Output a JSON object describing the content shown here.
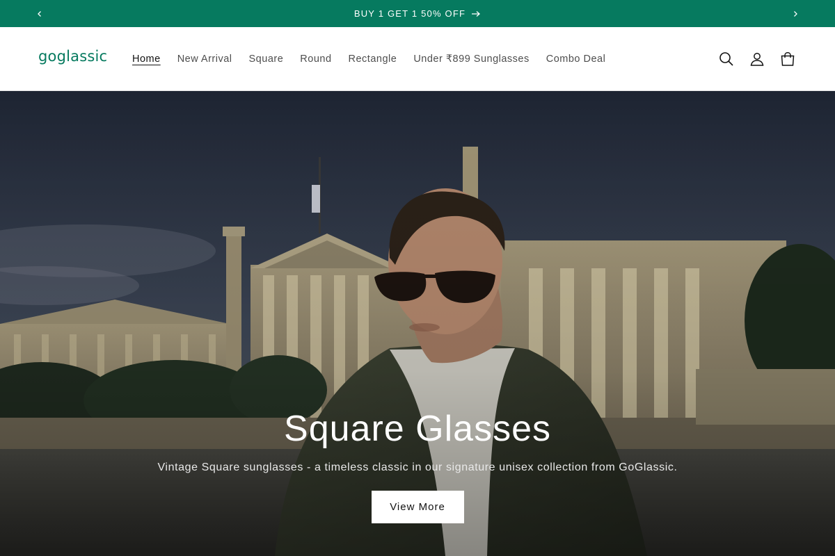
{
  "announcement": {
    "text": "BUY 1 GET 1 50% OFF",
    "prev_icon": "chevron-left-icon",
    "next_icon": "chevron-right-icon",
    "arrow_icon": "arrow-right-icon"
  },
  "header": {
    "logo": "goglassic",
    "nav": [
      {
        "label": "Home",
        "active": true
      },
      {
        "label": "New Arrival"
      },
      {
        "label": "Square"
      },
      {
        "label": "Round"
      },
      {
        "label": "Rectangle"
      },
      {
        "label": "Under ₹899 Sunglasses"
      },
      {
        "label": "Combo Deal"
      }
    ],
    "icons": [
      "search-icon",
      "account-icon",
      "cart-icon"
    ]
  },
  "hero": {
    "title": "Square Glasses",
    "subtitle": "Vintage Square sunglasses - a timeless classic in our signature unisex collection from GoGlassic.",
    "button": "View More"
  },
  "colors": {
    "brand": "#067a5f",
    "text": "#121212",
    "nav_text": "#4d4d4d",
    "white": "#ffffff"
  }
}
